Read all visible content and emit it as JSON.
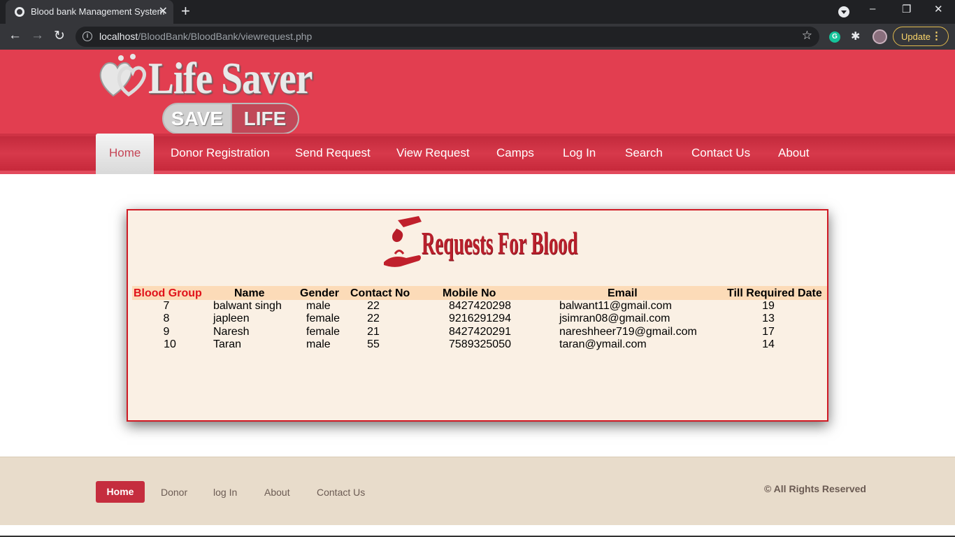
{
  "browser": {
    "tab_title": "Blood bank Management System",
    "tab_close": "✕",
    "new_tab": "+",
    "url_host": "localhost",
    "url_path": "/BloodBank/BloodBank/viewrequest.php",
    "update_label": "Update",
    "window_controls": [
      "–",
      "❐",
      "✕"
    ]
  },
  "site": {
    "brand": "Life Saver",
    "badge_left": "SAVE",
    "badge_right": "LIFE",
    "nav": [
      "Home",
      "Donor Registration",
      "Send Request",
      "View Request",
      "Camps",
      "Log In",
      "Search",
      "Contact Us",
      "About"
    ],
    "active_nav": "Home",
    "accent_color": "#e23e50"
  },
  "requests": {
    "heading": "Requests For Blood",
    "columns": [
      "Blood Group",
      "Name",
      "Gender",
      "Contact No",
      "Mobile No",
      "Email",
      "Till Required Date"
    ],
    "rows": [
      {
        "group": "7",
        "name": "balwant singh",
        "gender": "male",
        "contact": "22",
        "mobile": "8427420298",
        "email": "balwant11@gmail.com",
        "date": "19"
      },
      {
        "group": "8",
        "name": "japleen",
        "gender": "female",
        "contact": "22",
        "mobile": "9216291294",
        "email": "jsimran08@gmail.com",
        "date": "13"
      },
      {
        "group": "9",
        "name": "Naresh",
        "gender": "female",
        "contact": "21",
        "mobile": "8427420291",
        "email": "nareshheer719@gmail.com",
        "date": "17"
      },
      {
        "group": "10",
        "name": "Taran",
        "gender": "male",
        "contact": "55",
        "mobile": "7589325050",
        "email": "taran@ymail.com",
        "date": "14"
      }
    ]
  },
  "footer": {
    "links": [
      "Home",
      "Donor",
      "log In",
      "About",
      "Contact Us"
    ],
    "rights": "© All Rights Reserved"
  }
}
